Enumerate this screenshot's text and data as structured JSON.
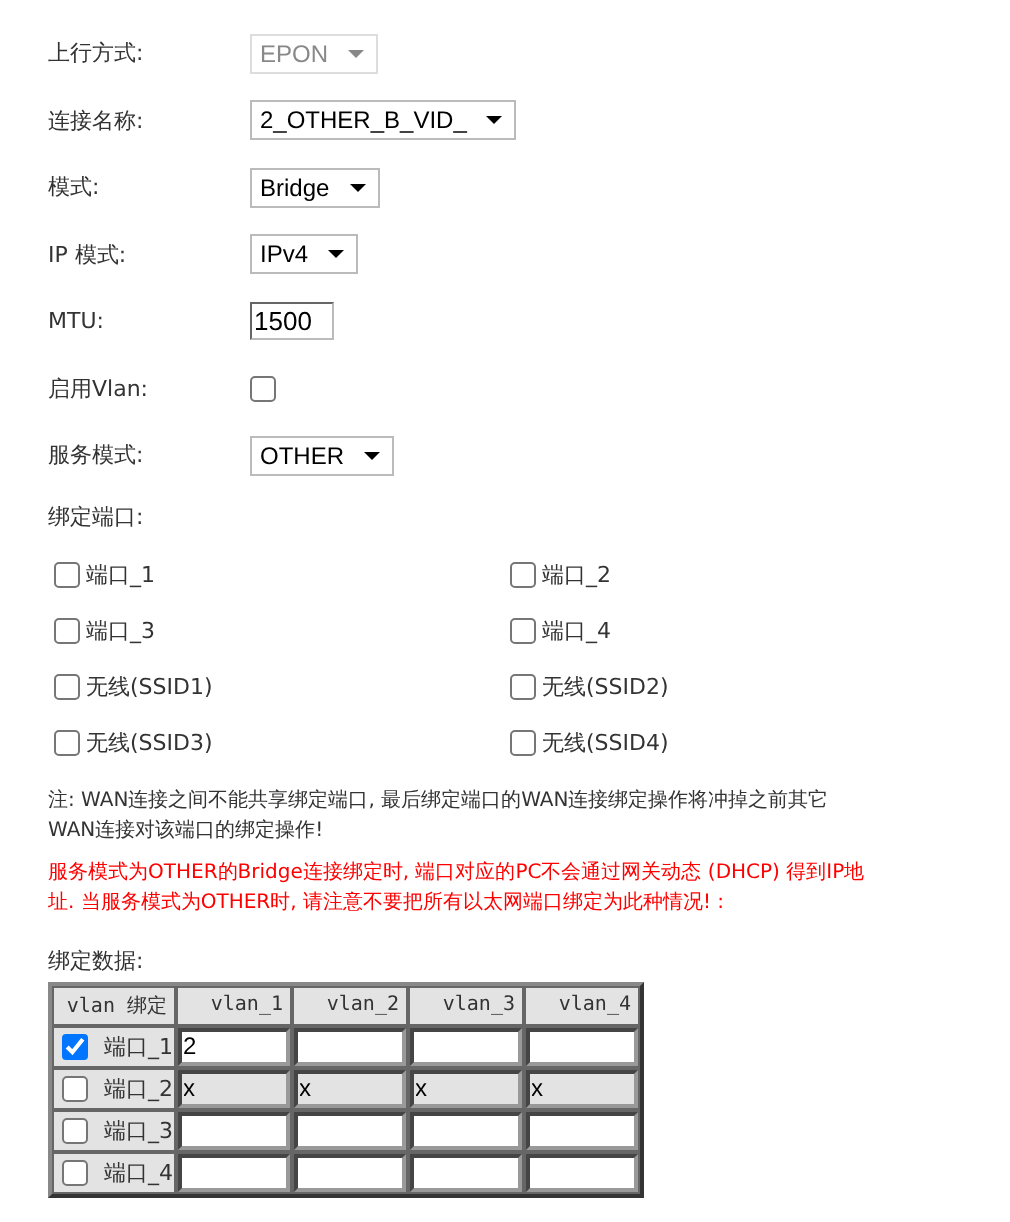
{
  "fields": [
    {
      "kind": "select",
      "label": "上行方式:",
      "value": "EPON",
      "disabled": true
    },
    {
      "kind": "select",
      "label": "连接名称:",
      "value": "2_OTHER_B_VID_",
      "disabled": false
    },
    {
      "kind": "select",
      "label": "模式:",
      "value": "Bridge",
      "disabled": false
    },
    {
      "kind": "select",
      "label": "IP 模式:",
      "value": "IPv4",
      "disabled": false
    },
    {
      "kind": "text",
      "label": "MTU:",
      "value": "1500"
    },
    {
      "kind": "checkbox",
      "label": "启用Vlan:",
      "checked": false
    },
    {
      "kind": "select",
      "label": "服务模式:",
      "value": "OTHER",
      "disabled": false
    }
  ],
  "bind_ports": {
    "title": "绑定端口:",
    "ports": [
      {
        "label": "端口_1",
        "checked": false
      },
      {
        "label": "端口_2",
        "checked": false
      },
      {
        "label": "端口_3",
        "checked": false
      },
      {
        "label": "端口_4",
        "checked": false
      },
      {
        "label": "无线(SSID1)",
        "checked": false
      },
      {
        "label": "无线(SSID2)",
        "checked": false
      },
      {
        "label": "无线(SSID3)",
        "checked": false
      },
      {
        "label": "无线(SSID4)",
        "checked": false
      }
    ]
  },
  "note": "注: WAN连接之间不能共享绑定端口, 最后绑定端口的WAN连接绑定操作将冲掉之前其它WAN连接对该端口的绑定操作!",
  "warning": "服务模式为OTHER的Bridge连接绑定时, 端口对应的PC不会通过网关动态 (DHCP) 得到IP地址. 当服务模式为OTHER时, 请注意不要把所有以太网端口绑定为此种情况! :",
  "bind_data": {
    "title": "绑定数据:",
    "columns": [
      "vlan 绑定",
      "vlan_1",
      "vlan_2",
      "vlan_3",
      "vlan_4"
    ],
    "rows": [
      {
        "checked": true,
        "disabled": false,
        "cells": [
          "端口_1",
          "2",
          "",
          "",
          ""
        ]
      },
      {
        "checked": false,
        "disabled": true,
        "cells": [
          "端口_2",
          "x",
          "x",
          "x",
          "x"
        ]
      },
      {
        "checked": false,
        "disabled": false,
        "cells": [
          "端口_3",
          "",
          "",
          "",
          ""
        ]
      },
      {
        "checked": false,
        "disabled": false,
        "cells": [
          "端口_4",
          "",
          "",
          "",
          ""
        ]
      }
    ]
  }
}
